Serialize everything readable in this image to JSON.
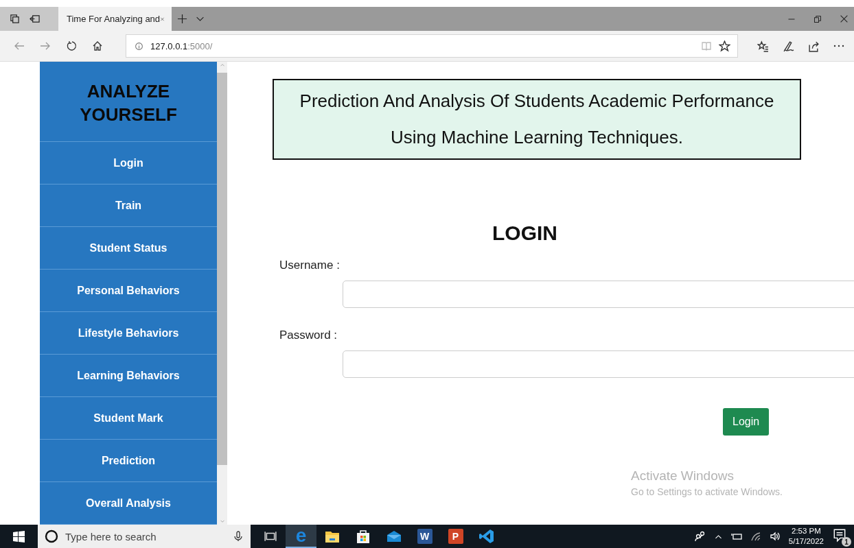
{
  "browser": {
    "tab_title": "Time For Analyzing and",
    "address": {
      "host": "127.0.0.1",
      "rest": ":5000/"
    }
  },
  "sidebar": {
    "title": "ANALYZE YOURSELF",
    "items": [
      {
        "label": "Login"
      },
      {
        "label": "Train"
      },
      {
        "label": "Student Status"
      },
      {
        "label": "Personal Behaviors"
      },
      {
        "label": "Lifestyle Behaviors"
      },
      {
        "label": "Learning Behaviors"
      },
      {
        "label": "Student Mark"
      },
      {
        "label": "Prediction"
      },
      {
        "label": "Overall Analysis"
      }
    ]
  },
  "banner": {
    "lines": [
      "Prediction And Analysis Of Students Academic Performance",
      "Using Machine Learning Techniques."
    ]
  },
  "login": {
    "heading": "LOGIN",
    "fields": [
      {
        "label": "Username :"
      },
      {
        "label": "Password :"
      }
    ],
    "button": "Login"
  },
  "activation": {
    "title": "Activate Windows",
    "subtitle": "Go to Settings to activate Windows."
  },
  "taskbar": {
    "search_placeholder": "Type here to search",
    "apps": [
      {
        "kind": "taskview",
        "active": false
      },
      {
        "kind": "edge",
        "active": true,
        "letter": "e"
      },
      {
        "kind": "explorer",
        "active": false
      },
      {
        "kind": "store",
        "active": false
      },
      {
        "kind": "mail",
        "active": false
      },
      {
        "kind": "word",
        "active": false,
        "letter": "W"
      },
      {
        "kind": "powerpoint",
        "active": false,
        "letter": "P"
      },
      {
        "kind": "vscode",
        "active": false
      }
    ],
    "time": "2:53 PM",
    "date": "5/17/2022",
    "notification_count": "1"
  }
}
